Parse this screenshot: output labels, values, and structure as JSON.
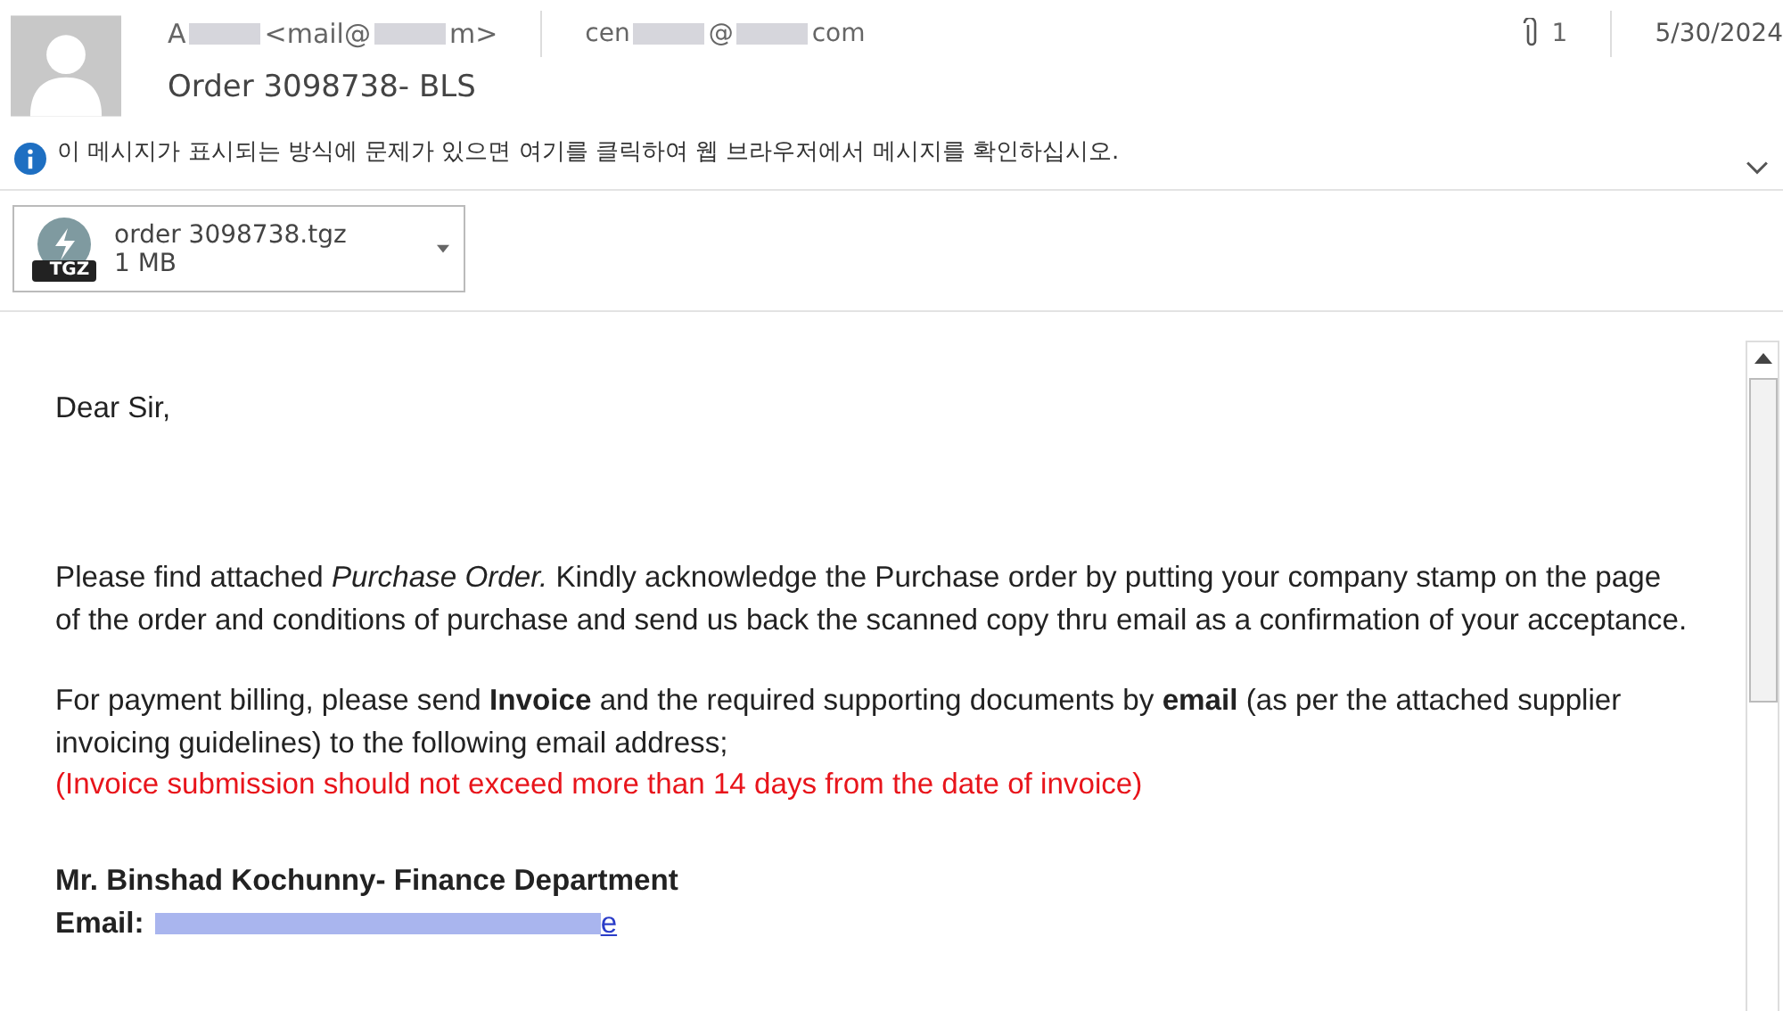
{
  "header": {
    "sender": [
      {
        "text": "A",
        "blur_before": false
      },
      {
        "text": "<mail@",
        "blur_before": true
      },
      {
        "text": "m>",
        "blur_before": true
      }
    ],
    "recipient": [
      {
        "text": "cen",
        "blur_before": false
      },
      {
        "text": "@",
        "blur_before": true
      },
      {
        "text": "com",
        "blur_before": true
      }
    ],
    "attachment_count": "1",
    "date": "5/30/2024",
    "subject": "Order 3098738- BLS",
    "info": "이 메시지가 표시되는 방식에 문제가 있으면 여기를 클릭하여 웹 브라우저에서 메시지를 확인하십시오."
  },
  "attachment": {
    "badge": "TGZ",
    "name": "order 3098738.tgz",
    "size": "1 MB"
  },
  "body": {
    "greeting": "Dear Sir,",
    "paragraphs": [
      {
        "kind": "normal",
        "text": "Please find attached *Purchase Order.* Kindly acknowledge the Purchase order by putting your company stamp on the page of the order and conditions of purchase and send us back the scanned copy thru email as a confirmation of your acceptance."
      },
      {
        "kind": "normal",
        "text": "For payment billing, please send **Invoice** and the required supporting documents by **email** (as per the attached supplier invoicing guidelines) to the following email address;"
      },
      {
        "kind": "warning",
        "text": "(Invoice submission should not exceed more than 14 days from the date of invoice)"
      }
    ],
    "contact_name": "Mr. Binshad Kochunny- Finance Department",
    "email_label": "Email:",
    "email": [
      {
        "text": "e",
        "blur_before": true
      }
    ]
  }
}
